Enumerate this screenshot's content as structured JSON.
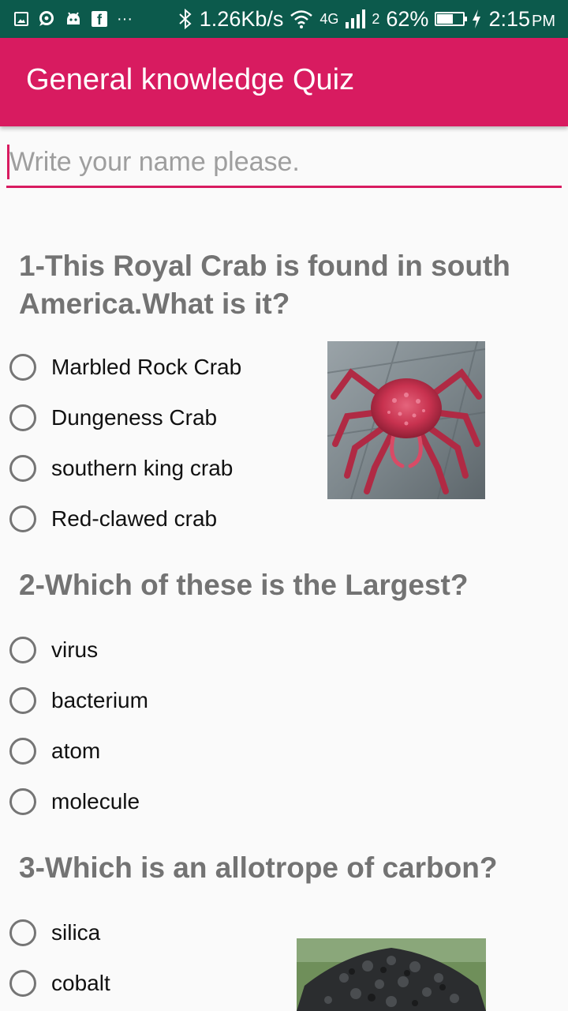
{
  "status_bar": {
    "network_speed": "1.26Kb/s",
    "network_type": "4G",
    "sim_slot": "2",
    "battery_percent": "62%",
    "battery_level": 0.62,
    "time": "2:15",
    "ampm": "PM",
    "more_indicator": "···"
  },
  "app_bar": {
    "title": "General knowledge Quiz"
  },
  "name_field": {
    "placeholder": "Write your name please.",
    "value": ""
  },
  "questions": [
    {
      "text": "1-This Royal Crab is found in south America.What is it?",
      "options": [
        "Marbled Rock Crab",
        "Dungeness Crab",
        "southern king crab",
        "Red-clawed crab"
      ],
      "image": "red-king-crab-photo"
    },
    {
      "text": "2-Which of these is the Largest?",
      "options": [
        "virus",
        "bacterium",
        "atom",
        "molecule"
      ]
    },
    {
      "text": "3-Which is an allotrope of carbon?",
      "options": [
        "silica",
        "cobalt"
      ],
      "image": "coal-pile-photo"
    }
  ],
  "colors": {
    "status_bar": "#0c5a4c",
    "accent": "#d81b60",
    "question_text": "#737373",
    "radio_border": "#757575"
  }
}
